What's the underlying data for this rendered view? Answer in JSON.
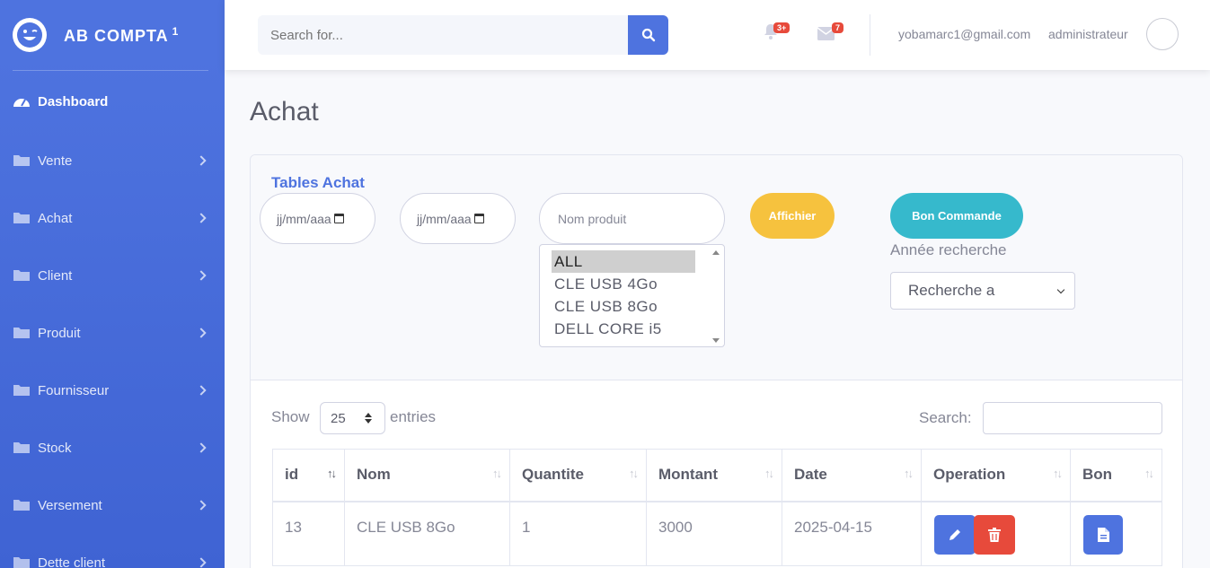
{
  "brand": {
    "name": "AB COMPTA",
    "sup": "1"
  },
  "sidebar": {
    "items": [
      {
        "label": "Dashboard",
        "icon": "tachometer-icon",
        "active": true
      },
      {
        "label": "Vente",
        "icon": "folder-icon"
      },
      {
        "label": "Achat",
        "icon": "folder-icon"
      },
      {
        "label": "Client",
        "icon": "folder-icon"
      },
      {
        "label": "Produit",
        "icon": "folder-icon"
      },
      {
        "label": "Fournisseur",
        "icon": "folder-icon"
      },
      {
        "label": "Stock",
        "icon": "folder-icon"
      },
      {
        "label": "Versement",
        "icon": "folder-icon"
      },
      {
        "label": "Dette client",
        "icon": "folder-icon"
      }
    ]
  },
  "topbar": {
    "search_placeholder": "Search for...",
    "alerts_badge": "3+",
    "messages_badge": "7",
    "user_email": "yobamarc1@gmail.com",
    "user_role": "administrateur"
  },
  "page": {
    "title": "Achat"
  },
  "filters": {
    "card_title": "Tables Achat",
    "date_from": "jj/mm/aaa",
    "date_to": "jj/mm/aaa",
    "product_placeholder": "Nom produit",
    "product_options": [
      "ALL",
      "CLE USB 4Go",
      "CLE USB 8Go",
      "DELL CORE i5"
    ],
    "selected_option": "ALL",
    "afficher_label": "Affichier",
    "bon_commande_label": "Bon Commande",
    "annee_label": "Année recherche",
    "annee_value": "Recherche a"
  },
  "table_controls": {
    "show_label": "Show",
    "entries_value": "25",
    "entries_label": "entries",
    "search_label": "Search:"
  },
  "table": {
    "columns": [
      "id",
      "Nom",
      "Quantite",
      "Montant",
      "Date",
      "Operation",
      "Bon"
    ],
    "rows": [
      {
        "id": "13",
        "nom": "CLE USB 8Go",
        "quantite": "1",
        "montant": "3000",
        "date": "2025-04-15"
      }
    ]
  },
  "colors": {
    "primary": "#4e73df",
    "warning": "#f6c23e",
    "info": "#36b9cc",
    "danger": "#e74a3b"
  }
}
